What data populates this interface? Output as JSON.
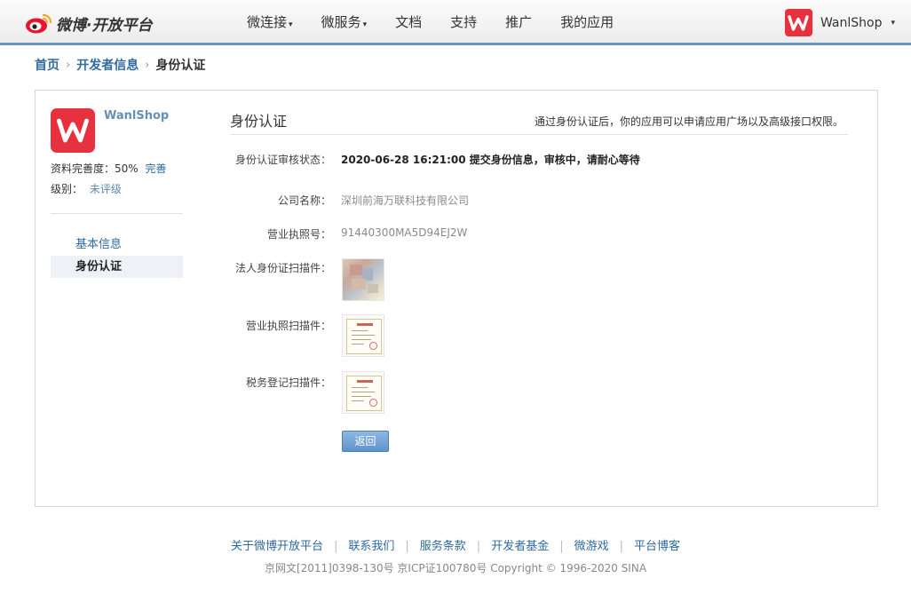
{
  "header": {
    "logo_text": "微博·开放平台",
    "nav": [
      {
        "label": "微连接",
        "has_caret": true
      },
      {
        "label": "微服务",
        "has_caret": true
      },
      {
        "label": "文档",
        "has_caret": false
      },
      {
        "label": "支持",
        "has_caret": false
      },
      {
        "label": "推广",
        "has_caret": false
      },
      {
        "label": "我的应用",
        "has_caret": false
      }
    ],
    "user_name": "WanlShop",
    "caret_icon": "▾"
  },
  "breadcrumb": {
    "items": [
      "首页",
      "开发者信息",
      "身份认证"
    ],
    "separator": "›"
  },
  "sidebar": {
    "app_name": "WanlShop",
    "completeness_label": "资料完善度：",
    "completeness_value": "50%",
    "complete_link": "完善",
    "level_label": "级别：",
    "level_value": "未评级",
    "menu": [
      {
        "label": "基本信息",
        "active": false
      },
      {
        "label": "身份认证",
        "active": true
      }
    ]
  },
  "content": {
    "title": "身份认证",
    "hint": "通过身份认证后，你的应用可以申请应用广场以及高级接口权限。",
    "status_label": "身份认证审核状态：",
    "status_value": "2020-06-28 16:21:00 提交身份信息，审核中，请耐心等待",
    "company_label": "公司名称：",
    "company_value": "深圳前海万联科技有限公司",
    "license_no_label": "营业执照号：",
    "license_no_value": "91440300MA5D94EJ2W",
    "id_scan_label": "法人身份证扫描件：",
    "license_scan_label": "营业执照扫描件：",
    "tax_scan_label": "税务登记扫描件：",
    "back_button": "返回"
  },
  "footer": {
    "links": [
      "关于微博开放平台",
      "联系我们",
      "服务条款",
      "开发者基金",
      "微游戏",
      "平台博客"
    ],
    "separator": "|",
    "copyright": "京网文[2011]0398-130号 京ICP证100780号 Copyright © 1996-2020 SINA"
  },
  "colors": {
    "brand_red": "#e8313f",
    "link_blue": "#2f6aa0",
    "header_rule": "#6a95c6"
  }
}
